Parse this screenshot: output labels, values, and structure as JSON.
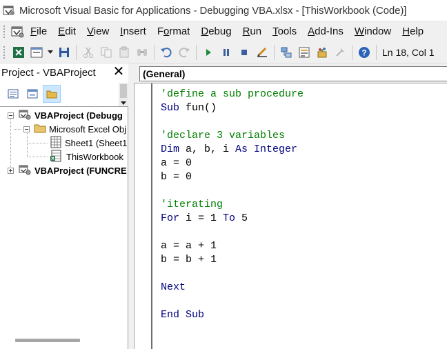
{
  "window": {
    "title": "Microsoft Visual Basic for Applications - Debugging VBA.xlsx - [ThisWorkbook (Code)]"
  },
  "menu": {
    "items": [
      {
        "pre": "",
        "ul": "F",
        "post": "ile"
      },
      {
        "pre": "",
        "ul": "E",
        "post": "dit"
      },
      {
        "pre": "",
        "ul": "V",
        "post": "iew"
      },
      {
        "pre": "",
        "ul": "I",
        "post": "nsert"
      },
      {
        "pre": "F",
        "ul": "o",
        "post": "rmat"
      },
      {
        "pre": "",
        "ul": "D",
        "post": "ebug"
      },
      {
        "pre": "",
        "ul": "R",
        "post": "un"
      },
      {
        "pre": "",
        "ul": "T",
        "post": "ools"
      },
      {
        "pre": "",
        "ul": "A",
        "post": "dd-Ins"
      },
      {
        "pre": "",
        "ul": "W",
        "post": "indow"
      },
      {
        "pre": "",
        "ul": "H",
        "post": "elp"
      }
    ]
  },
  "toolbar": {
    "cursor_position": "Ln 18, Col 1"
  },
  "project_pane": {
    "title": "Project - VBAProject",
    "close_glyph": "✕",
    "tree": [
      {
        "label": "VBAProject (Debugg",
        "bold": true
      },
      {
        "label": "Microsoft Excel Obj",
        "bold": false
      },
      {
        "label": "Sheet1 (Sheet1",
        "bold": false
      },
      {
        "label": "ThisWorkbook",
        "bold": false
      },
      {
        "label": "VBAProject (FUNCRE",
        "bold": true
      }
    ]
  },
  "code_pane": {
    "object_combo": "(General)",
    "lines": [
      [
        {
          "t": "c",
          "s": "'define a sub procedure"
        }
      ],
      [
        {
          "t": "k",
          "s": "Sub"
        },
        {
          "t": "t",
          "s": " fun()"
        }
      ],
      [],
      [
        {
          "t": "c",
          "s": "'declare 3 variables"
        }
      ],
      [
        {
          "t": "k",
          "s": "Dim"
        },
        {
          "t": "t",
          "s": " a, b, i "
        },
        {
          "t": "k",
          "s": "As Integer"
        }
      ],
      [
        {
          "t": "t",
          "s": "a = 0"
        }
      ],
      [
        {
          "t": "t",
          "s": "b = 0"
        }
      ],
      [],
      [
        {
          "t": "c",
          "s": "'iterating"
        }
      ],
      [
        {
          "t": "k",
          "s": "For"
        },
        {
          "t": "t",
          "s": " i = 1 "
        },
        {
          "t": "k",
          "s": "To"
        },
        {
          "t": "t",
          "s": " 5"
        }
      ],
      [],
      [
        {
          "t": "t",
          "s": "a = a + 1"
        }
      ],
      [
        {
          "t": "t",
          "s": "b = b + 1"
        }
      ],
      [],
      [
        {
          "t": "k",
          "s": "Next"
        }
      ],
      [],
      [
        {
          "t": "k",
          "s": "End Sub"
        }
      ]
    ]
  },
  "colors": {
    "keyword": "#00007f",
    "comment": "#007f00",
    "chrome": "#f0f0f0"
  }
}
